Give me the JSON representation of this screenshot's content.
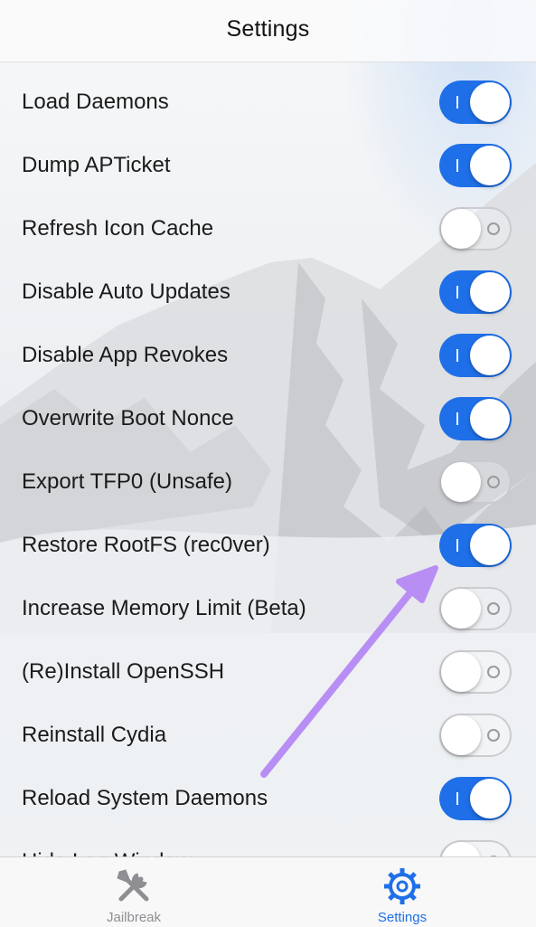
{
  "navbar": {
    "title": "Settings"
  },
  "settings": [
    {
      "label": "Load Daemons",
      "on": true
    },
    {
      "label": "Dump APTicket",
      "on": true
    },
    {
      "label": "Refresh Icon Cache",
      "on": false
    },
    {
      "label": "Disable Auto Updates",
      "on": true
    },
    {
      "label": "Disable App Revokes",
      "on": true
    },
    {
      "label": "Overwrite Boot Nonce",
      "on": true
    },
    {
      "label": "Export TFP0 (Unsafe)",
      "on": false
    },
    {
      "label": "Restore RootFS (rec0ver)",
      "on": true
    },
    {
      "label": "Increase Memory Limit (Beta)",
      "on": false
    },
    {
      "label": "(Re)Install OpenSSH",
      "on": false
    },
    {
      "label": "Reinstall Cydia",
      "on": false
    },
    {
      "label": "Reload System Daemons",
      "on": true
    },
    {
      "label": "Hide Log Window",
      "on": false
    }
  ],
  "tabbar": {
    "tabs": [
      {
        "label": "Jailbreak",
        "icon": "tools-icon",
        "active": false
      },
      {
        "label": "Settings",
        "icon": "gear-icon",
        "active": true
      }
    ]
  },
  "colors": {
    "accent": "#1f6fe8",
    "annotation_arrow": "#b88ef5",
    "inactive_tab": "#8e8e93"
  }
}
